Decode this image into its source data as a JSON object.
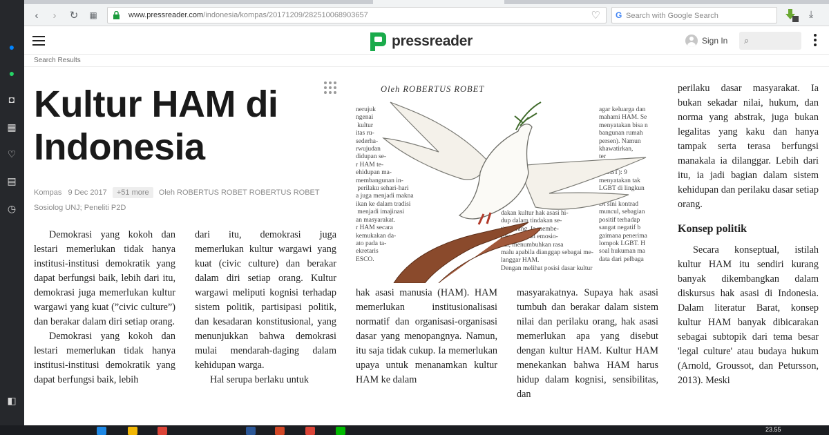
{
  "browser": {
    "url_host": "www.pressreader.com",
    "url_path": "/indonesia/kompas/20171209/282510068903657",
    "search_placeholder": "Search with Google Search",
    "google_letter": "G"
  },
  "app": {
    "logo_text": "pressreader",
    "sign_in": "Sign In",
    "breadcrumb": "Search Results"
  },
  "article": {
    "title": "Kultur HAM di Indonesia",
    "source": "Kompas",
    "date": "9 Dec 2017",
    "more": "+51 more",
    "author": "Oleh ROBERTUS ROBET ROBERTUS ROBET Sosiolog UNJ; Peneliti P2D",
    "byline": "Oleh ROBERTUS ROBET",
    "col1": [
      "Demokrasi yang kokoh dan lestari memerlukan tidak hanya institusi-institusi demokratik yang dapat berfungsi baik, lebih dari itu, demokrasi juga memerlukan kultur wargawi yang kuat (”civic culture”) dan berakar dalam diri setiap orang.",
      "Demokrasi yang kokoh dan lestari memerlukan tidak hanya institusi-institusi demokratik yang dapat berfungsi baik, lebih"
    ],
    "col2": [
      "dari itu, demokrasi juga memerlukan kultur wargawi yang kuat (civic culture) dan berakar dalam diri setiap orang. Kultur wargawi meliputi kognisi terhadap sistem politik, partisipasi politik, dan kesadaran konstitusional, yang menunjukkan bahwa demokrasi mulai mendarah-daging dalam kehidupan warga.",
      "Hal serupa berlaku untuk"
    ],
    "col3": "hak asasi manusia (HAM). HAM memerlukan institusionalisasi normatif dan organisasi-organisasi dasar yang menopangnya. Namun, itu saja tidak cukup. Ia memerlukan upaya untuk menanamkan kultur HAM ke dalam",
    "col4": "masyarakatnya. Supaya hak asasi tumbuh dan berakar dalam sistem nilai dan perilaku orang, hak asasi memerlukan apa yang disebut dengan kultur HAM. Kultur HAM menekankan bahwa HAM harus hidup dalam kognisi, sensibilitas, dan",
    "col5": [
      "perilaku dasar masyarakat. Ia bukan sekadar nilai, hukum, dan norma yang abstrak, juga bukan legalitas yang kaku dan hanya tampak serta terasa berfungsi manakala ia dilanggar. Lebih dari itu, ia jadi bagian dalam sistem kehidupan dan perilaku dasar setiap orang."
    ],
    "subhead": "Konsep politik",
    "col5b": "Secara konseptual, istilah kultur HAM itu sendiri kurang banyak dikembangkan dalam diskursus hak asasi di Indonesia. Dalam literatur Barat, konsep kultur HAM banyak dibicarakan sebagai subtopik dari tema besar 'legal culture' atau budaya hukum (Arnold, Groussot, dan Petursson, 2013). Meski",
    "frag_left": "nerujuk\nngenai\n kultur\nitas ru-\nsederha-\nrwujudan\ndidupan se-\nr HAM te-\nehidupan ma-\nmembangunan in-\n perilaku sehari-hari\na juga menjadi makna\nikan ke dalam tradisi\n menjadi imajinasi\nan masyarakat.\nr HAM secara\nkemukakan da-\nato pada ta-\nekretaris\nESCO.",
    "frag_mid": "dakan kultur hak asasi hi-\ndup dalam tindakan se-\ntiap orang. Ia membe-\nrikan pijakan emosio-\nnal, menumbuhkan rasa\nmalu apabila dianggap sebagai me-\nlanggar HAM.\nDengan melihat posisi dasar kultur",
    "frag_right": "agar keluarga dan\nmahami HAM. Se\nmenyatakan bisa n\nbangunan rumah\npersen). Namun\nkhawatirkan,\nter\nseks\n(LGBT): 9\nmenyatakan tak\nLGBT di lingkun\nreka.\nDi sini kontrad\nmuncul, sebagian\npositif terhadap\nsangat negatif b\ngaimana penerima\nlompok LGBT. H\nsoal hukuman ma\ndata dari pelbaga"
  },
  "taskbar": {
    "clock": "23.55"
  },
  "colors": {
    "logo_green": "#1aab4b",
    "bg": "#ffffff",
    "dock": "#26282c"
  }
}
